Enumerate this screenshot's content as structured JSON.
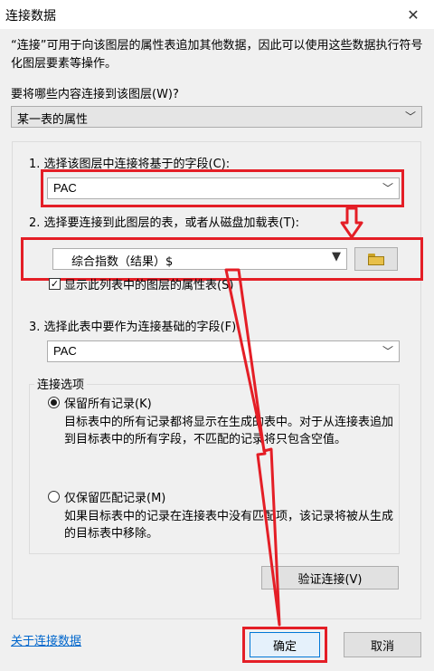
{
  "window": {
    "title": "连接数据",
    "close_glyph": "✕"
  },
  "description": "“连接”可用于向该图层的属性表追加其他数据，因此可以使用这些数据执行符号化图层要素等操作。",
  "join_what": {
    "label": "要将哪些内容连接到该图层(W)?",
    "selected": "某一表的属性"
  },
  "step1": {
    "label": "1. 选择该图层中连接将基于的字段(C):",
    "selected": "PAC"
  },
  "step2": {
    "label": "2. 选择要连接到此图层的表，或者从磁盘加载表(T):",
    "selected": "综合指数（结果）$",
    "checkbox_label": "显示此列表中的图层的属性表(S)",
    "checkbox_checked": true
  },
  "step3": {
    "label": "3. 选择此表中要作为连接基础的字段(F):",
    "selected": "PAC"
  },
  "options": {
    "legend": "连接选项",
    "keep_all": {
      "label": "保留所有记录(K)",
      "desc": "目标表中的所有记录都将显示在生成的表中。对于从连接表追加到目标表中的所有字段，不匹配的记录将只包含空值。",
      "selected": true
    },
    "keep_matching": {
      "label": "仅保留匹配记录(M)",
      "desc": "如果目标表中的记录在连接表中没有匹配项，该记录将被从生成的目标表中移除。",
      "selected": false
    }
  },
  "buttons": {
    "validate": "验证连接(V)",
    "ok": "确定",
    "cancel": "取消",
    "about_link": "关于连接数据"
  },
  "colors": {
    "annotation_red": "#e41e26",
    "link_blue": "#0066cc"
  }
}
